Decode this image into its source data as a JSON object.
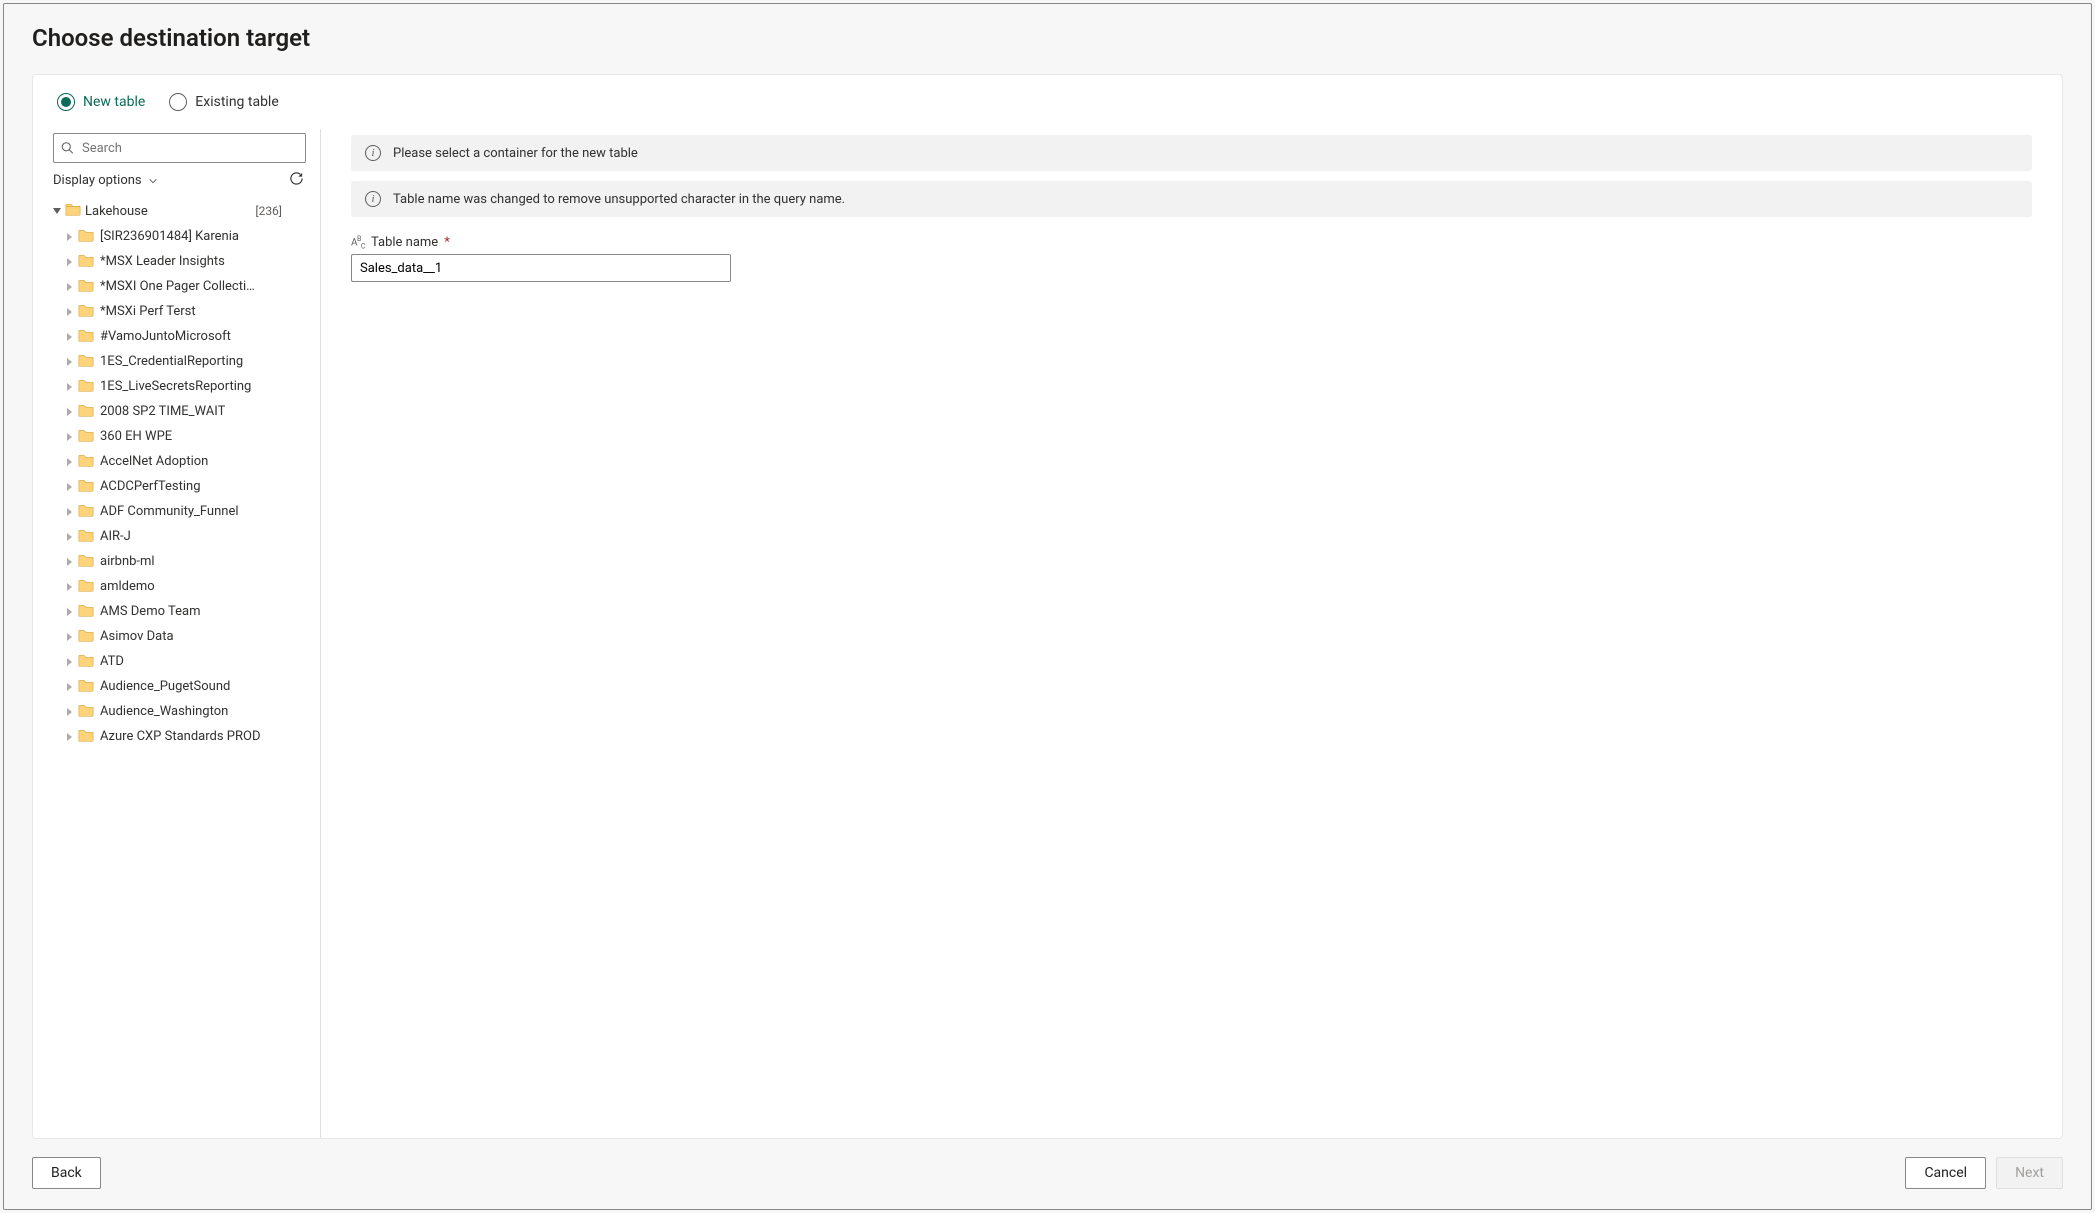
{
  "dialog": {
    "title": "Choose destination target"
  },
  "radios": {
    "new_table": "New table",
    "existing_table": "Existing table"
  },
  "search": {
    "placeholder": "Search"
  },
  "toolbar": {
    "display_options": "Display options"
  },
  "tree": {
    "root_label": "Lakehouse",
    "root_count": "[236]",
    "items": [
      "[SIR236901484] Karenia",
      "*MSX Leader Insights",
      "*MSXI One Pager Collecti…",
      "*MSXi Perf Terst",
      "#VamoJuntoMicrosoft",
      "1ES_CredentialReporting",
      "1ES_LiveSecretsReporting",
      "2008 SP2 TIME_WAIT",
      "360 EH WPE",
      "AccelNet Adoption",
      "ACDCPerfTesting",
      "ADF Community_Funnel",
      "AIR-J",
      "airbnb-ml",
      "amldemo",
      "AMS Demo Team",
      "Asimov Data",
      "ATD",
      "Audience_PugetSound",
      "Audience_Washington",
      "Azure CXP Standards PROD"
    ]
  },
  "banners": {
    "select_container": "Please select a container for the new table",
    "name_changed": "Table name was changed to remove unsupported character in the query name."
  },
  "field": {
    "label": "Table name",
    "value": "Sales_data__1"
  },
  "footer": {
    "back": "Back",
    "cancel": "Cancel",
    "next": "Next"
  }
}
